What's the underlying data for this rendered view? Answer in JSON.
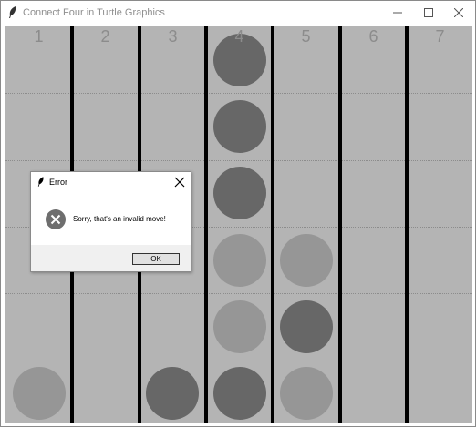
{
  "window": {
    "title": "Connect Four in Turtle Graphics",
    "icon": "feather-icon",
    "controls": [
      "minimize-icon",
      "maximize-icon",
      "close-icon"
    ]
  },
  "board": {
    "columns": [
      "1",
      "2",
      "3",
      "4",
      "5",
      "6",
      "7"
    ],
    "rows": 6,
    "colors": {
      "background": "#b4b4b4",
      "player_dark": "#676767",
      "player_light": "#969696",
      "divider": "#000000"
    },
    "pieces": [
      {
        "col": 4,
        "row": 1,
        "player": "dark"
      },
      {
        "col": 4,
        "row": 2,
        "player": "dark"
      },
      {
        "col": 4,
        "row": 3,
        "player": "dark"
      },
      {
        "col": 4,
        "row": 4,
        "player": "light"
      },
      {
        "col": 5,
        "row": 4,
        "player": "light"
      },
      {
        "col": 4,
        "row": 5,
        "player": "light"
      },
      {
        "col": 5,
        "row": 5,
        "player": "dark"
      },
      {
        "col": 1,
        "row": 6,
        "player": "light"
      },
      {
        "col": 3,
        "row": 6,
        "player": "dark"
      },
      {
        "col": 4,
        "row": 6,
        "player": "dark"
      },
      {
        "col": 5,
        "row": 6,
        "player": "light"
      }
    ]
  },
  "dialog": {
    "title": "Error",
    "message": "Sorry, that's an invalid move!",
    "ok_label": "OK",
    "icon": "error-icon"
  }
}
